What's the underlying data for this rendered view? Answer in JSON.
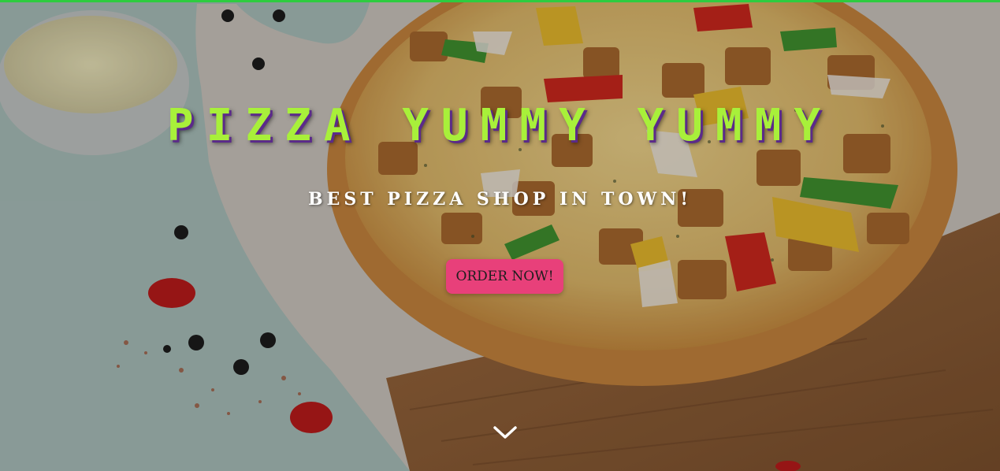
{
  "hero": {
    "title": "PIZZA YUMMY YUMMY",
    "tagline": "BEST PIZZA SHOP IN TOWN!",
    "cta_label": "ORDER NOW!",
    "scroll_icon": "chevron-down-icon"
  },
  "colors": {
    "top_strip": "#2ecc40",
    "title": "#a8f03a",
    "title_shadow": "#5b2a8a",
    "cta_background": "#e8407a",
    "tagline": "#ffffff"
  }
}
